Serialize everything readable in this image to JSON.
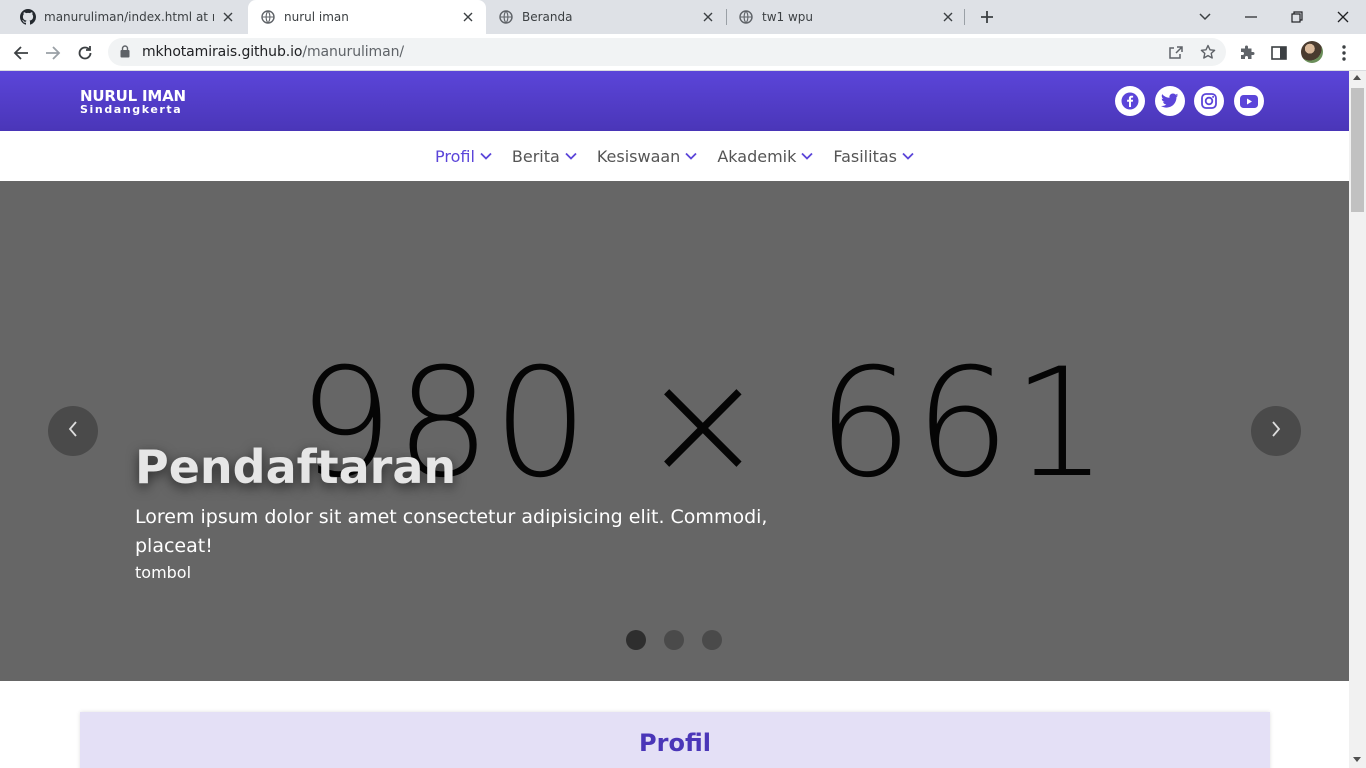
{
  "browser": {
    "tabs": [
      {
        "title": "manuruliman/index.html at main",
        "favicon": "github-icon",
        "active": false
      },
      {
        "title": "nurul iman",
        "favicon": "globe-icon",
        "active": true
      },
      {
        "title": "Beranda",
        "favicon": "globe-icon",
        "active": false
      },
      {
        "title": "tw1 wpu",
        "favicon": "globe-icon",
        "active": false
      }
    ],
    "url_host": "mkhotamirais.github.io",
    "url_path": "/manuruliman/"
  },
  "site": {
    "brand_name": "NURUL IMAN",
    "brand_sub": "Sindangkerta",
    "social": [
      "facebook-icon",
      "twitter-icon",
      "instagram-icon",
      "youtube-icon"
    ],
    "accent_color": "#5b45d9",
    "menu": [
      {
        "label": "Profil",
        "active": true
      },
      {
        "label": "Berita",
        "active": false
      },
      {
        "label": "Kesiswaan",
        "active": false
      },
      {
        "label": "Akademik",
        "active": false
      },
      {
        "label": "Fasilitas",
        "active": false
      }
    ]
  },
  "hero": {
    "placeholder": "980 × 661",
    "heading": "Pendaftaran",
    "description": "Lorem ipsum dolor sit amet consectetur adipisicing elit. Commodi, placeat!",
    "button": "tombol",
    "slides": 3,
    "active_slide": 1
  },
  "section": {
    "profil_title": "Profil"
  }
}
